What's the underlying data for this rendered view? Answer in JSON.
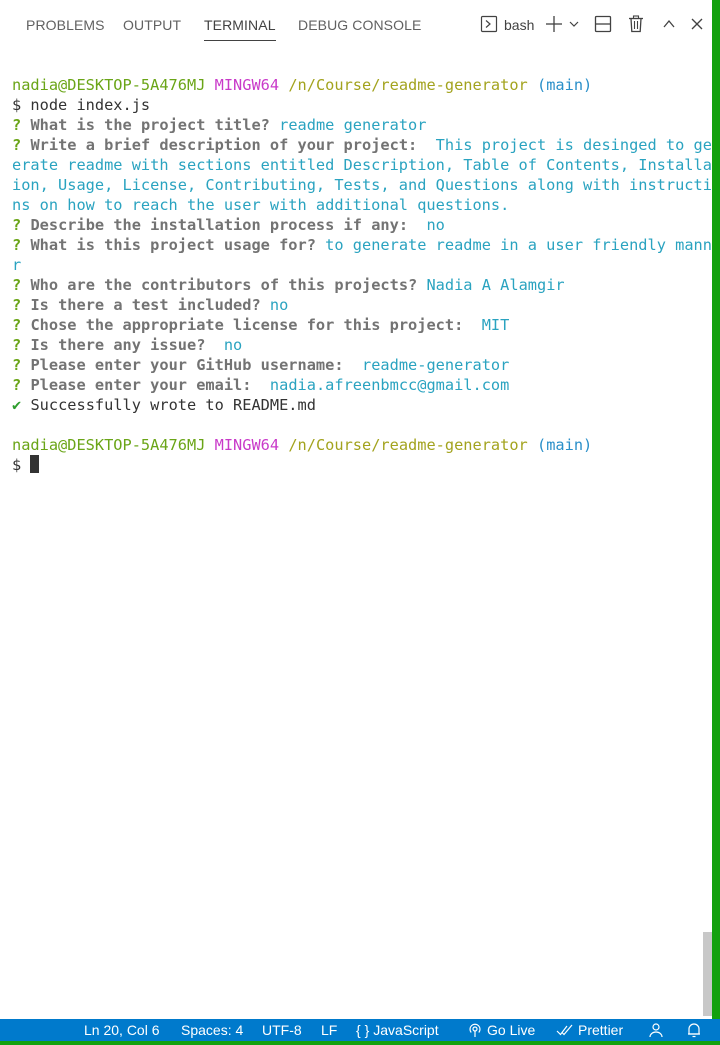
{
  "panel": {
    "tabs": [
      {
        "label": "PROBLEMS"
      },
      {
        "label": "OUTPUT"
      },
      {
        "label": "TERMINAL"
      },
      {
        "label": "DEBUG CONSOLE"
      }
    ],
    "active_tab": "TERMINAL",
    "shell_label": "bash"
  },
  "terminal": {
    "prompt1": {
      "user": "nadia@DESKTOP-5A476MJ",
      "env": "MINGW64",
      "path": "/n/Course/readme-generator",
      "branch": "(main)"
    },
    "command": "$ node index.js",
    "lines": [
      {
        "q": "?",
        "text": "What is the project title?",
        "answer": "readme generator"
      },
      {
        "q": "?",
        "text": "Write a brief description of your project:",
        "answer": " This project is desinged to gen"
      },
      {
        "wrap": "erate readme with sections entitled Description, Table of Contents, Installat"
      },
      {
        "wrap": "ion, Usage, License, Contributing, Tests, and Questions along with instructio"
      },
      {
        "wrap": "ns on how to reach the user with additional questions."
      },
      {
        "q": "?",
        "text": "Describe the installation process if any:",
        "answer": " no"
      },
      {
        "q": "?",
        "text": "What is this project usage for?",
        "answer": "to generate readme in a user friendly manne"
      },
      {
        "wrap": "r"
      },
      {
        "q": "?",
        "text": "Who are the contributors of this projects?",
        "answer": "Nadia A Alamgir"
      },
      {
        "q": "?",
        "text": "Is there a test included?",
        "answer": "no"
      },
      {
        "q": "?",
        "text": "Chose the appropriate license for this project:",
        "answer": " MIT"
      },
      {
        "q": "?",
        "text": "Is there any issue?",
        "answer": " no"
      },
      {
        "q": "?",
        "text": "Please enter your GitHub username:",
        "answer": " readme-generator"
      },
      {
        "q": "?",
        "text": "Please enter your email:",
        "answer": " nadia.afreenbmcc@gmail.com"
      }
    ],
    "success": {
      "mark": "✔",
      "text": "Successfully wrote to README.md"
    },
    "prompt2": {
      "user": "nadia@DESKTOP-5A476MJ",
      "env": "MINGW64",
      "path": "/n/Course/readme-generator",
      "branch": "(main)"
    },
    "final_prompt": "$ "
  },
  "statusbar": {
    "position": "Ln 20, Col 6",
    "spaces": "Spaces: 4",
    "encoding": "UTF-8",
    "eol": "LF",
    "language_icon": "{ }",
    "language": "JavaScript",
    "golive": "Go Live",
    "prettier": "Prettier"
  },
  "colors": {
    "statusbar_bg": "#007acc",
    "window_border": "#13a10e",
    "prompt_user": "#6aa517",
    "prompt_env": "#c93ac9",
    "prompt_path": "#a3a31e",
    "prompt_branch": "#2a8fc9",
    "answer": "#2aa3c0"
  }
}
